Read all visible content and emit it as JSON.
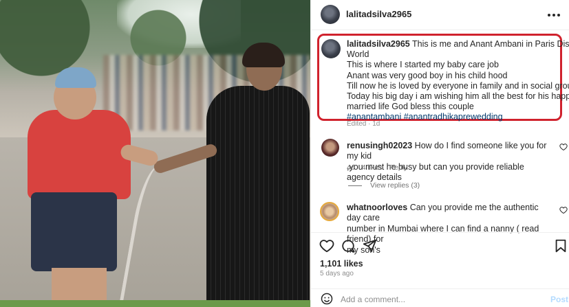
{
  "post": {
    "username": "lalitadsilva2965",
    "caption_lines": [
      "This is me and Anant Ambani in Paris Disney",
      "World",
      "This is where I started my baby care job",
      "Anant was very good boy in his child hood",
      "Till now he is loved by everyone in family and in social group",
      "Today his big day i am wishing him all the best for his happy",
      "married life God bless this couple"
    ],
    "hashtags": "#anantambani #anantradhikaprewedding",
    "edited": "Edited · 1d",
    "likes": "1,101 likes",
    "date": "5 days ago"
  },
  "comments": [
    {
      "username": "renusingh02023",
      "text_lines": [
        " How do I find someone like you for my kid",
        ",you must he busy but can you provide reliable agency details"
      ],
      "age": "4d",
      "likes": "4 likes",
      "reply": "Reply",
      "view_replies": "View replies (3)"
    },
    {
      "username": "whatnoorloves",
      "text_lines": [
        " Can you provide me the authentic day care",
        "number in Mumbai where I can find a nanny ( read friend) for",
        "my son's"
      ]
    }
  ],
  "add_comment": {
    "placeholder": "Add a comment...",
    "post_label": "Post"
  },
  "icons": [
    "more-icon",
    "heart-icon",
    "comment-icon",
    "share-icon",
    "bookmark-icon",
    "emoji-icon"
  ],
  "colors": {
    "highlight_border": "#d0222d",
    "hashtag": "#00376b",
    "post_button": "#b3dbff"
  }
}
